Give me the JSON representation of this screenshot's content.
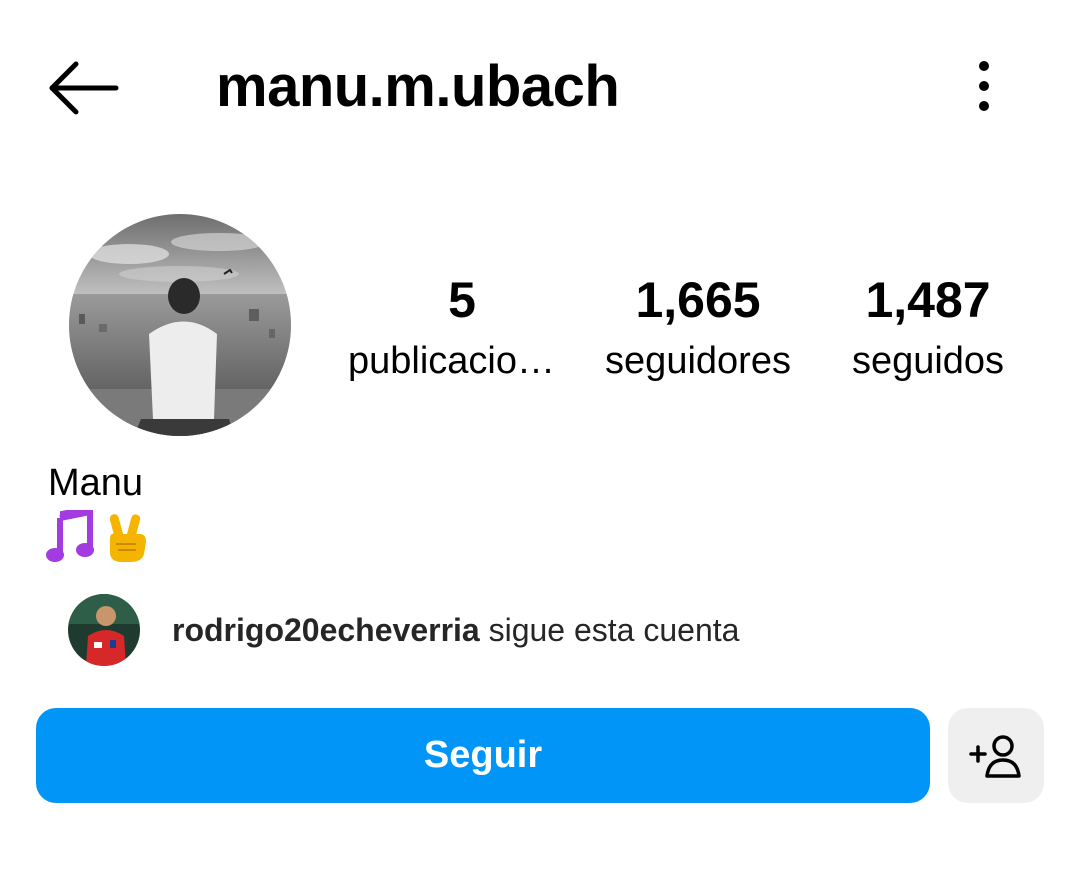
{
  "header": {
    "username": "manu.m.ubach",
    "back_icon": "arrow-left-icon",
    "more_icon": "more-vertical-icon"
  },
  "profile": {
    "avatar_icon": "profile-photo",
    "stats": [
      {
        "value": "5",
        "label": "publicaciones"
      },
      {
        "value": "1,665",
        "label": "seguidores"
      },
      {
        "value": "1,487",
        "label": "seguidos"
      }
    ],
    "full_name": "Manu",
    "bio_emojis": [
      "musical-notes-emoji",
      "victory-hand-emoji"
    ]
  },
  "followed_by": {
    "username": "rodrigo20echeverria",
    "suffix": " sigue esta cuenta"
  },
  "actions": {
    "follow_label": "Seguir",
    "suggest_icon": "add-person-icon"
  },
  "colors": {
    "primary_button": "#0095f6",
    "secondary_button": "#efefef",
    "text": "#000000"
  }
}
